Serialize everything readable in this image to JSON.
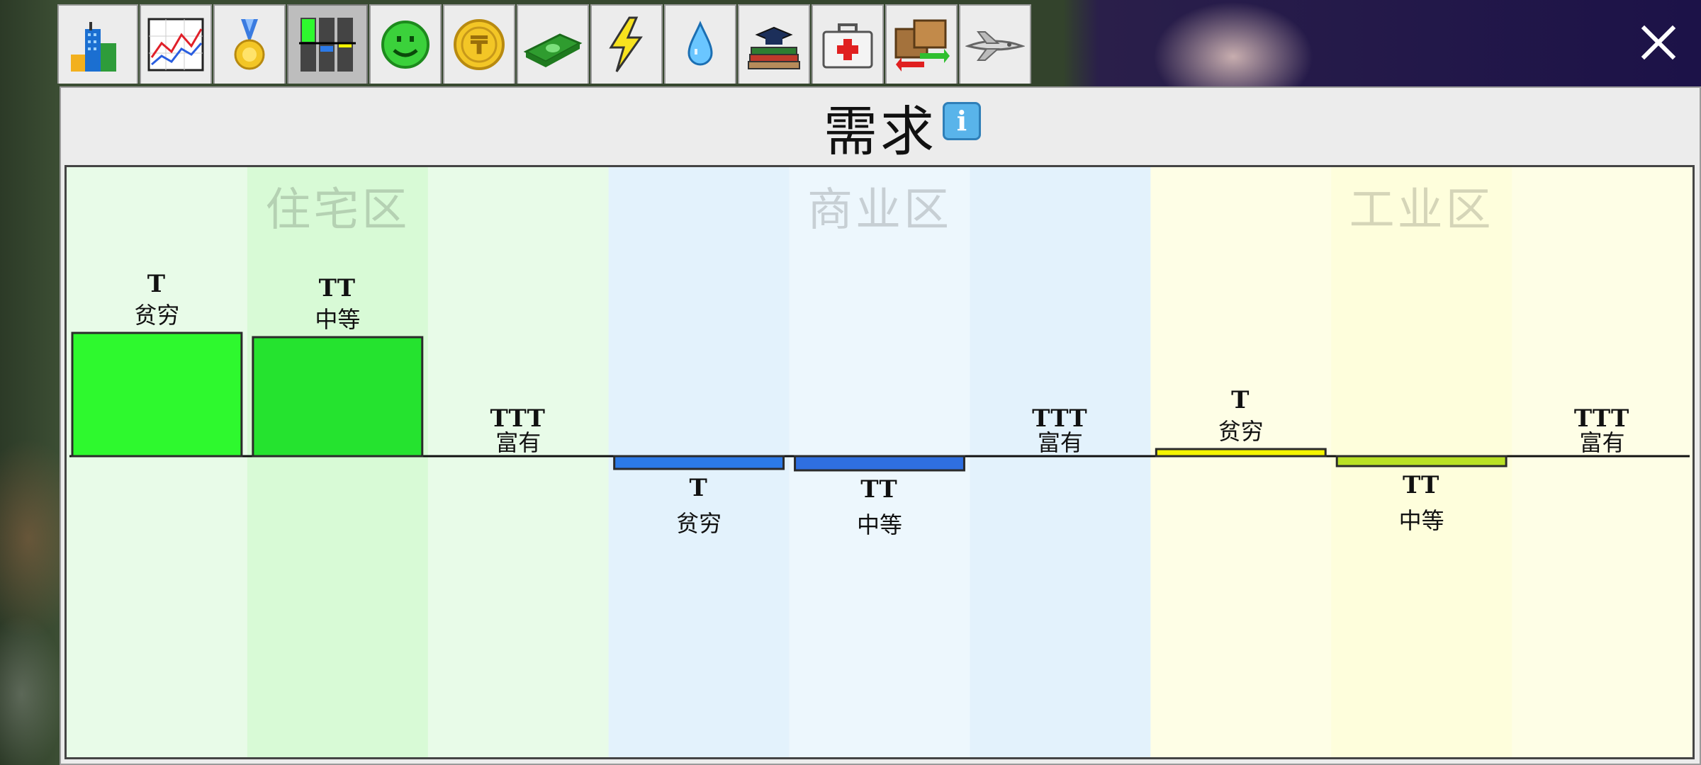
{
  "tabs": [
    {
      "name": "city-buildings-icon",
      "active": false
    },
    {
      "name": "line-graph-icon",
      "active": false
    },
    {
      "name": "medal-icon",
      "active": false
    },
    {
      "name": "demand-bars-icon",
      "active": true
    },
    {
      "name": "smiley-icon",
      "active": false
    },
    {
      "name": "coin-icon",
      "active": false
    },
    {
      "name": "cash-icon",
      "active": false
    },
    {
      "name": "lightning-icon",
      "active": false
    },
    {
      "name": "water-drop-icon",
      "active": false
    },
    {
      "name": "education-icon",
      "active": false
    },
    {
      "name": "medical-kit-icon",
      "active": false
    },
    {
      "name": "trade-boxes-icon",
      "active": false
    },
    {
      "name": "airplane-icon",
      "active": false
    }
  ],
  "panel": {
    "title": "需求",
    "info_icon": "i",
    "close_icon": "close-icon"
  },
  "chart_data": {
    "type": "bar",
    "zones": [
      {
        "label": "住宅区",
        "bg": "#e8fbe8",
        "bg_mid": "#d8fad6",
        "bar_colors": [
          "#2ef92e",
          "#25e32f",
          "#22d62a"
        ]
      },
      {
        "label": "商业区",
        "bg": "#e3f2fc",
        "bg_mid": "#edf7fd",
        "bar_colors": [
          "#2c7ae8",
          "#2f6fe0",
          "#2a66d4"
        ]
      },
      {
        "label": "工业区",
        "bg": "#fefee6",
        "bg_mid": "#fefedc",
        "bar_colors": [
          "#f4f400",
          "#b9e124",
          "#9dd020"
        ]
      }
    ],
    "categories": [
      "贫穷",
      "中等",
      "富有"
    ],
    "tier_symbols": [
      "T",
      "TT",
      "TTT"
    ],
    "series": [
      {
        "name": "住宅区",
        "values": [
          0.87,
          0.84,
          0
        ]
      },
      {
        "name": "商业区",
        "values": [
          -0.09,
          -0.1,
          0
        ]
      },
      {
        "name": "工业区",
        "values": [
          0.05,
          -0.07,
          0
        ]
      }
    ],
    "ylim": [
      -1,
      1
    ]
  }
}
